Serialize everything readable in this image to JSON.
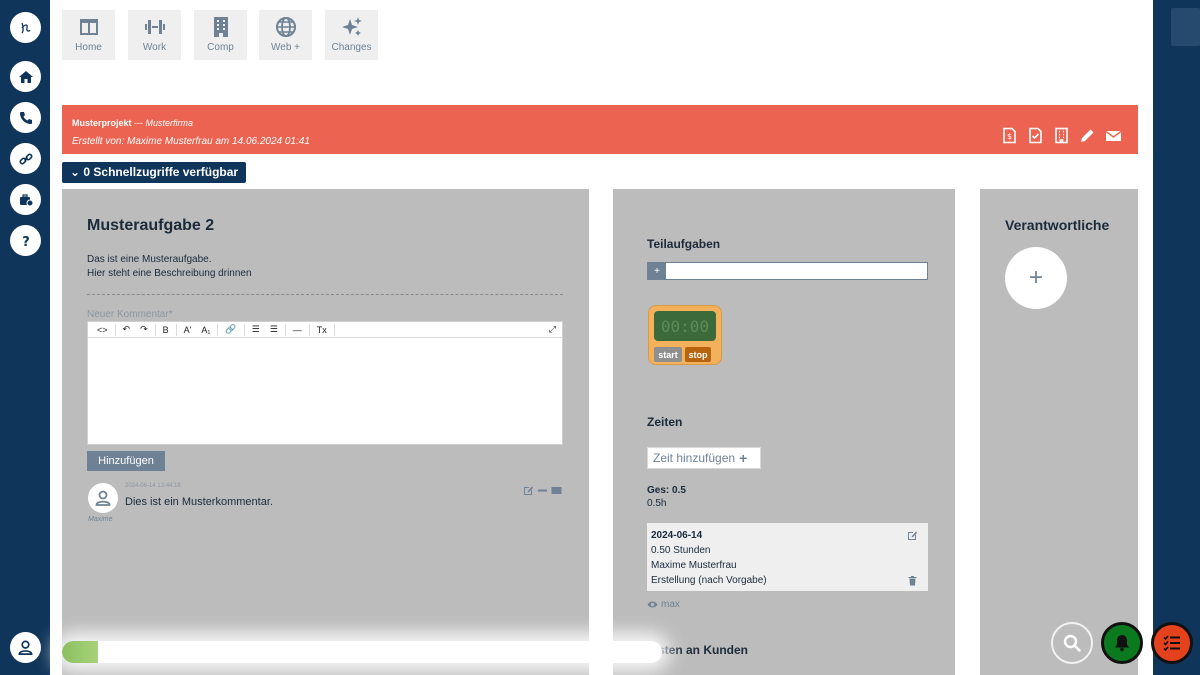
{
  "tiles": [
    {
      "label": "Home",
      "icon": "columns-icon"
    },
    {
      "label": "Work",
      "icon": "dumbbell-icon"
    },
    {
      "label": "Comp",
      "icon": "building-icon"
    },
    {
      "label": "Web +",
      "icon": "globe-icon"
    },
    {
      "label": "Changes",
      "icon": "sparkles-icon"
    }
  ],
  "banner": {
    "project": "Musterprojekt",
    "separator": " --- ",
    "company": "Musterfirma",
    "created": "Erstellt von: Maxime Musterfrau am 14.06.2024 01:41",
    "color": "#ec6451"
  },
  "quick_access": "0 Schnellzugriffe verfügbar",
  "task": {
    "title": "Musteraufgabe 2",
    "description_line1": "Das ist eine Musteraufgabe.",
    "description_line2": "Hier steht eine Beschreibung drinnen",
    "comment_label": "Neuer Kommentar*",
    "add_button": "Hinzufügen"
  },
  "toolbar_buttons": [
    "<>",
    "↶",
    "↷",
    "B",
    "A'",
    "A₁",
    "🔗",
    "☰",
    "☰",
    "—",
    "Tx"
  ],
  "comment": {
    "date": "2024-06-14 13:44:18",
    "text": "Dies ist ein Musterkommentar.",
    "author": "Maxime"
  },
  "subtasks": {
    "title": "Teilaufgaben",
    "add": "+"
  },
  "timer": {
    "display": "00:00",
    "start": "start",
    "stop": "stop"
  },
  "times": {
    "title": "Zeiten",
    "add_label": "Zeit hinzufügen",
    "add_plus": "+",
    "total": "Ges: 0.5",
    "total_h": "0.5h",
    "entry": {
      "date": "2024-06-14",
      "hours": "0.50 Stunden",
      "person": "Maxime Musterfrau",
      "type": "Erstellung (nach Vorgabe)"
    },
    "max_label": "max"
  },
  "costs_title": "sten an Kunden",
  "responsible": {
    "title": "Verantwortliche",
    "add": "+"
  },
  "progress": {
    "fraction": 0.06
  },
  "colors": {
    "navy": "#10355a",
    "panel": "#bcbcbc",
    "accent_green": "#0b7a1f",
    "accent_orange": "#e4411d"
  }
}
